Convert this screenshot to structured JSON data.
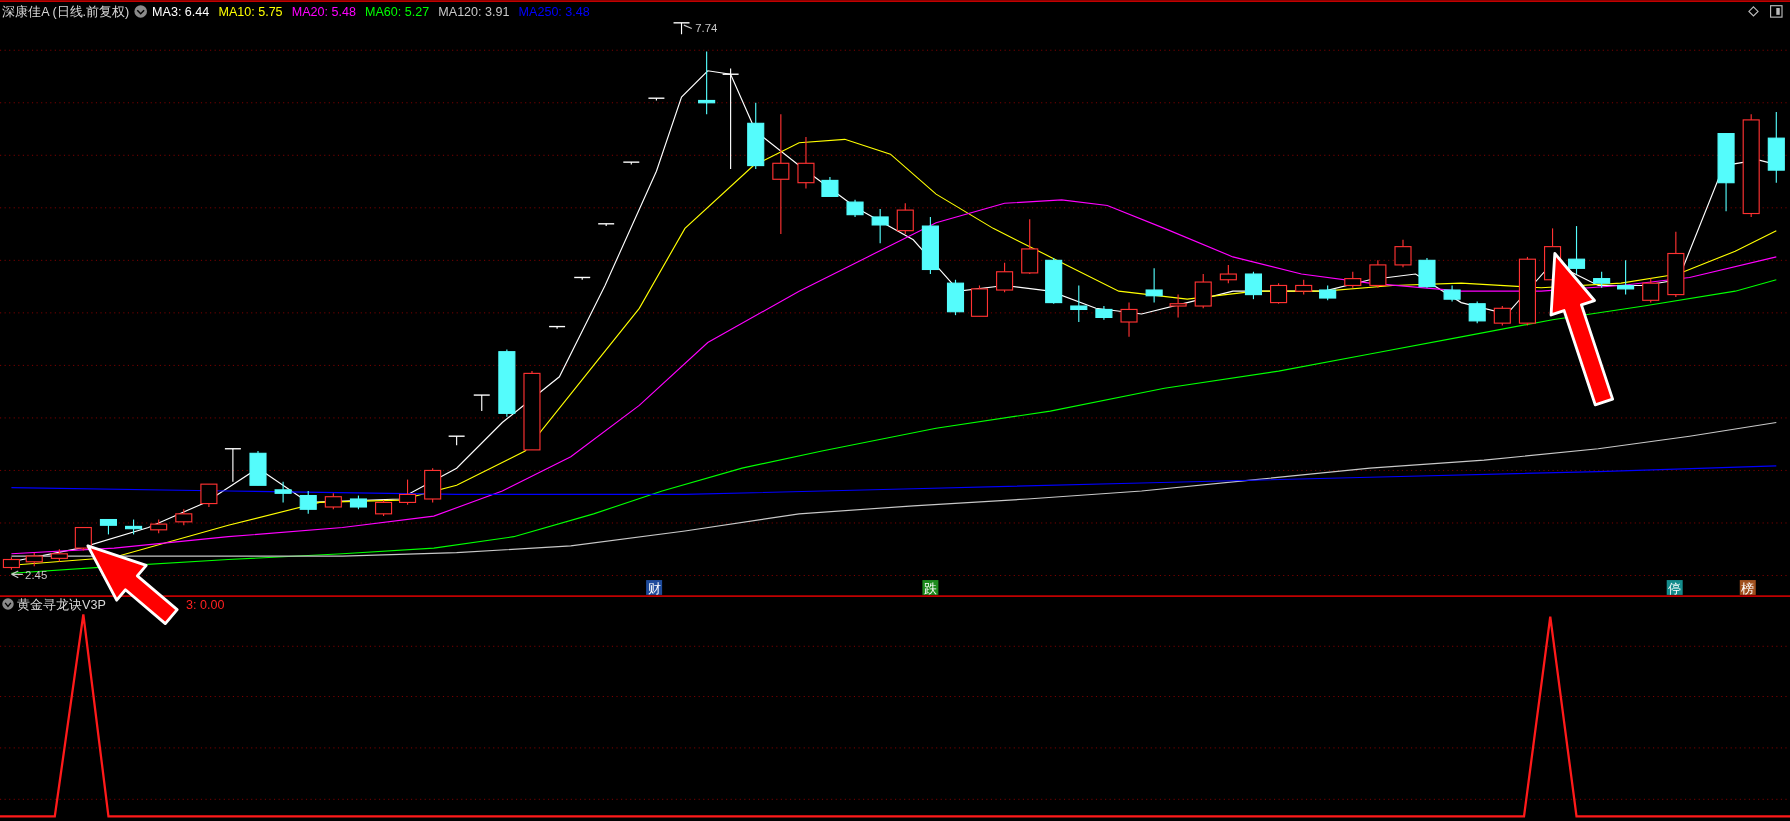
{
  "header": {
    "title": "深康佳A (日线.前复权)",
    "indicators": [
      {
        "label": "MA3: 6.44",
        "color": "#ffffff"
      },
      {
        "label": "MA10: 5.75",
        "color": "#ffff00"
      },
      {
        "label": "MA20: 5.48",
        "color": "#ff00ff"
      },
      {
        "label": "MA60: 5.27",
        "color": "#00ff00"
      },
      {
        "label": "MA120: 3.91",
        "color": "#c8c8c8"
      },
      {
        "label": "MA250: 3.48",
        "color": "#0000ff"
      }
    ]
  },
  "price_chart": {
    "high_label": "7.74",
    "low_label": "2.45",
    "signals": [
      {
        "text": "财",
        "color": "#1e4b9c"
      },
      {
        "text": "跌",
        "color": "#1d8a1d"
      },
      {
        "text": "停",
        "color": "#148c8c"
      },
      {
        "text": "榜",
        "color": "#a0501e"
      }
    ]
  },
  "sub_indicator": {
    "title": "黄金寻龙诀V3P",
    "value": "3: 0.00"
  }
}
